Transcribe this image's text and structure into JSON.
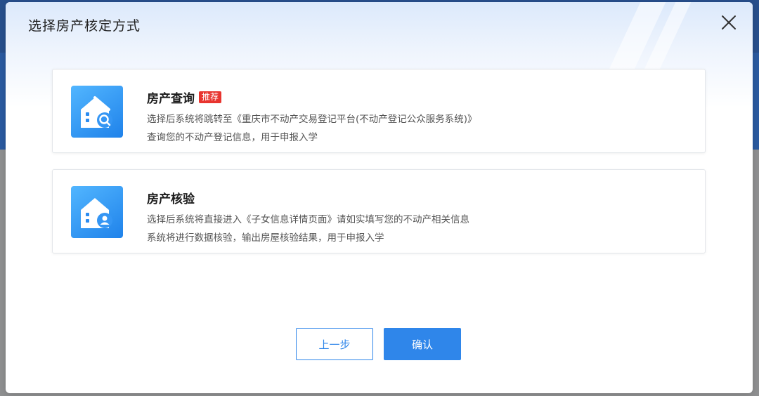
{
  "dialog": {
    "title": "选择房产核定方式",
    "close_icon": "close-icon"
  },
  "options": [
    {
      "title": "房产查询",
      "badge": "推荐",
      "icon": "house-search-icon",
      "desc_line1": "选择后系统将跳转至《重庆市不动产交易登记平台(不动产登记公众服务系统)》",
      "desc_line2": "查询您的不动产登记信息，用于申报入学"
    },
    {
      "title": "房产核验",
      "icon": "house-user-icon",
      "desc_line1": "选择后系统将直接进入《子女信息详情页面》请如实填写您的不动产相关信息",
      "desc_line2": "系统将进行数据核验，输出房屋核验结果，用于申报入学"
    }
  ],
  "footer": {
    "prev_label": "上一步",
    "confirm_label": "确认"
  },
  "colors": {
    "primary": "#2f86ea",
    "badge": "#e8342f"
  }
}
